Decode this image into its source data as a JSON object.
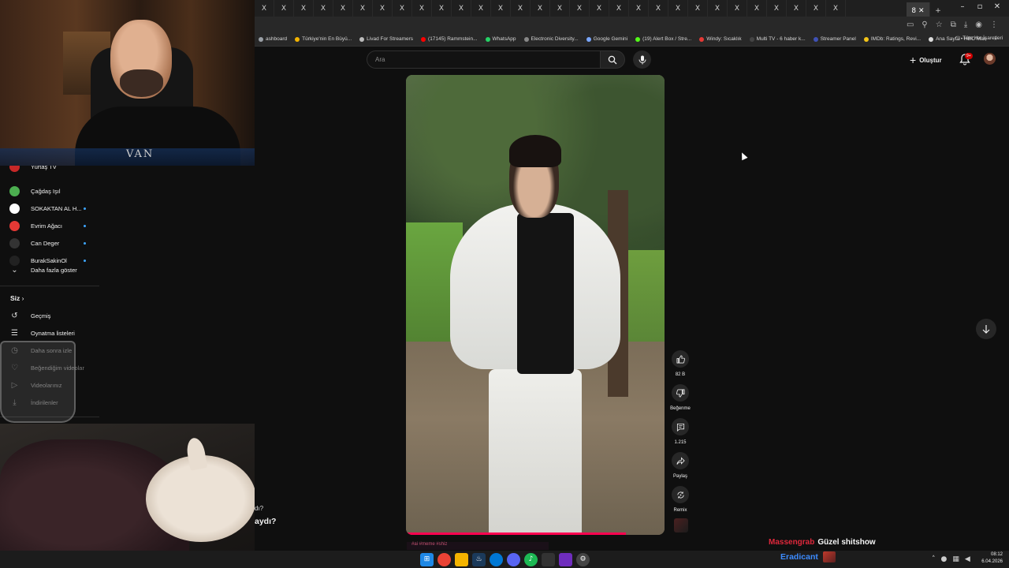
{
  "browser": {
    "tabs": [
      "X",
      "X",
      "X",
      "X",
      "X",
      "X",
      "X",
      "X",
      "X",
      "X",
      "X",
      "X",
      "X",
      "X",
      "X",
      "X",
      "X",
      "X",
      "X",
      "X",
      "X",
      "X",
      "X",
      "X",
      "X",
      "X",
      "X",
      "X",
      "X",
      "X"
    ],
    "active_tab": "8",
    "new_tab": "+",
    "window_controls": [
      "–",
      "▫",
      "✕"
    ],
    "bookmarks": [
      {
        "label": "ashboard",
        "color": "#9aa0a6"
      },
      {
        "label": "Türkiye'nin En Büyü...",
        "color": "#f4b400"
      },
      {
        "label": "Livad For Streamers",
        "color": "#bbbbbb"
      },
      {
        "label": "(17145) Rammstein...",
        "color": "#ff0000"
      },
      {
        "label": "WhatsApp",
        "color": "#25d366"
      },
      {
        "label": "Electronic Diversity...",
        "color": "#888888"
      },
      {
        "label": "Google Gemini",
        "color": "#7aa7ff"
      },
      {
        "label": "(19) Alert Box / Stre...",
        "color": "#53fc18"
      },
      {
        "label": "Windy: Sıcaklık",
        "color": "#e53935"
      },
      {
        "label": "Multi TV - 6 haber k...",
        "color": "#444444"
      },
      {
        "label": "Streamer Panel",
        "color": "#3f51b5"
      },
      {
        "label": "IMDb: Ratings, Revi...",
        "color": "#f5c518"
      },
      {
        "label": "Ana Sayfa • HBO Max",
        "color": "#dddddd"
      }
    ],
    "bookmarks_more": "»",
    "all_bookmarks": "Tüm Yer İşaretleri"
  },
  "youtube": {
    "search_placeholder": "Ara",
    "create_label": "Oluştur",
    "notif_count": "9+",
    "actions": {
      "like_count": "82 B",
      "dislike_label": "Beğenme",
      "comments_count": "1.215",
      "share_label": "Paylaş",
      "remix_label": "Remix"
    },
    "caption_fragment": "#ai #meme #shiz"
  },
  "sidebar": {
    "subscriptions": [
      {
        "name": "Yurtaş TV",
        "color": "#c62828",
        "dot": false
      },
      {
        "name": "Çağdaş Işıl",
        "color": "#4caf50",
        "dot": false
      },
      {
        "name": "SOKAKTAN AL H...",
        "color": "#ffffff",
        "dot": true
      },
      {
        "name": "Evrim Ağacı",
        "color": "#e53935",
        "dot": true
      },
      {
        "name": "Can Deger",
        "color": "#333333",
        "dot": true
      },
      {
        "name": "BurakSakinOl",
        "color": "#222222",
        "dot": true
      }
    ],
    "show_more": "Daha fazla göster",
    "you_section": "Siz",
    "you_items": [
      "Geçmiş",
      "Oynatma listeleri",
      "Daha sonra izle",
      "Beğendiğim videolar",
      "Videolarınız",
      "İndirilenler"
    ]
  },
  "overlay": {
    "stray_line1": "dı?",
    "stray_line2": "aydı?",
    "cam_logo": "VAN",
    "chat": [
      {
        "user": "Massengrab",
        "message": "Güzel shitshow"
      },
      {
        "user": "Eradicant",
        "message": ""
      }
    ]
  },
  "taskbar": {
    "time": "08:12",
    "date": "6.04.2026"
  }
}
